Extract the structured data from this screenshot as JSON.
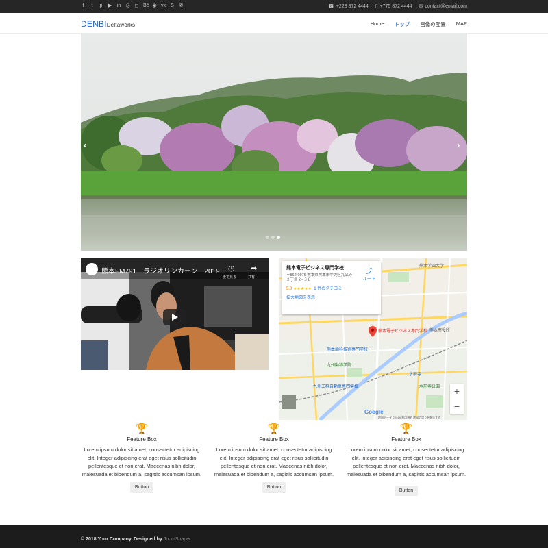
{
  "topbar": {
    "social_icons": [
      "facebook-icon",
      "twitter-icon",
      "pinterest-icon",
      "youtube-icon",
      "linkedin-icon",
      "dribbble-icon",
      "instagram-icon",
      "behance-icon",
      "flickr-icon",
      "vk-icon",
      "skype-icon",
      "whatsapp-icon"
    ],
    "social_glyphs": [
      "f",
      "t",
      "p",
      "▶",
      "in",
      "◎",
      "◻",
      "Bē",
      "◉",
      "vk",
      "S",
      "✆"
    ],
    "phone1": "+228 872 4444",
    "phone2": "+775 872 4444",
    "email": "contact@email.com"
  },
  "header": {
    "brand": "DENBI",
    "brand_sub": "Deltaworks",
    "brand_color": "#1763c8",
    "nav": [
      "Home",
      "トップ",
      "画像の配置",
      "MAP"
    ],
    "active_nav": "トップ"
  },
  "hero": {
    "prev_glyph": "‹",
    "next_glyph": "›",
    "dots_count": 3,
    "active_dot": 2
  },
  "video": {
    "title": "熊本FM791　ラジオリンカーン　2019...",
    "watch_later": "後で見る",
    "share": "共有"
  },
  "map": {
    "place_name": "熊本電子ビジネス専門学校",
    "address": "〒862-0976 熊本県熊本市中央区九品寺２丁目２−３８",
    "rating": "5.0",
    "stars": "★★★★★",
    "reviews": "1 件のクチコミ",
    "larger_map": "拡大地図を表示",
    "route": "ルート",
    "pin_label": "熊本電子ビジネス専門学校",
    "labels": [
      "熊本学園大学",
      "熊本市役所",
      "九州動物学院",
      "熊本歯科技術専門学校",
      "水前寺",
      "九州工科自動車専門学校",
      "水前寺公園"
    ],
    "google": "Google",
    "attribution": "地図データ ©2019   利用規約   地図の誤りを報告する",
    "zoom_in": "+",
    "zoom_out": "−"
  },
  "features": [
    {
      "title": "Feature Box",
      "text": "Lorem ipsum dolor sit amet, consectetur adipiscing elit. Integer adipiscing erat eget risus sollicitudin pellentesque et non erat. Maecenas nibh dolor, malesuada et bibendum a, sagittis accumsan ipsum.",
      "button": "Button"
    },
    {
      "title": "Feature Box",
      "text": "Lorem ipsum dolor sit amet, consectetur adipiscing elit. Integer adipiscing erat eget risus sollicitudin pellentesque et non erat. Maecenas nibh dolor, malesuada et bibendum a, sagittis accumsan ipsum.",
      "button": "Button"
    },
    {
      "title": "Feature Box",
      "text": "Lorem ipsum dolor sit amet, consectetur adipiscing elit. Integer adipiscing erat eget risus sollicitudin pellentesque et non erat. Maecenas nibh dolor, malesuada et bibendum a, sagittis accumsan ipsum.",
      "button": "Button"
    }
  ],
  "footer": {
    "text": "© 2018 Your Company. Designed by ",
    "link": "JoomShaper"
  }
}
